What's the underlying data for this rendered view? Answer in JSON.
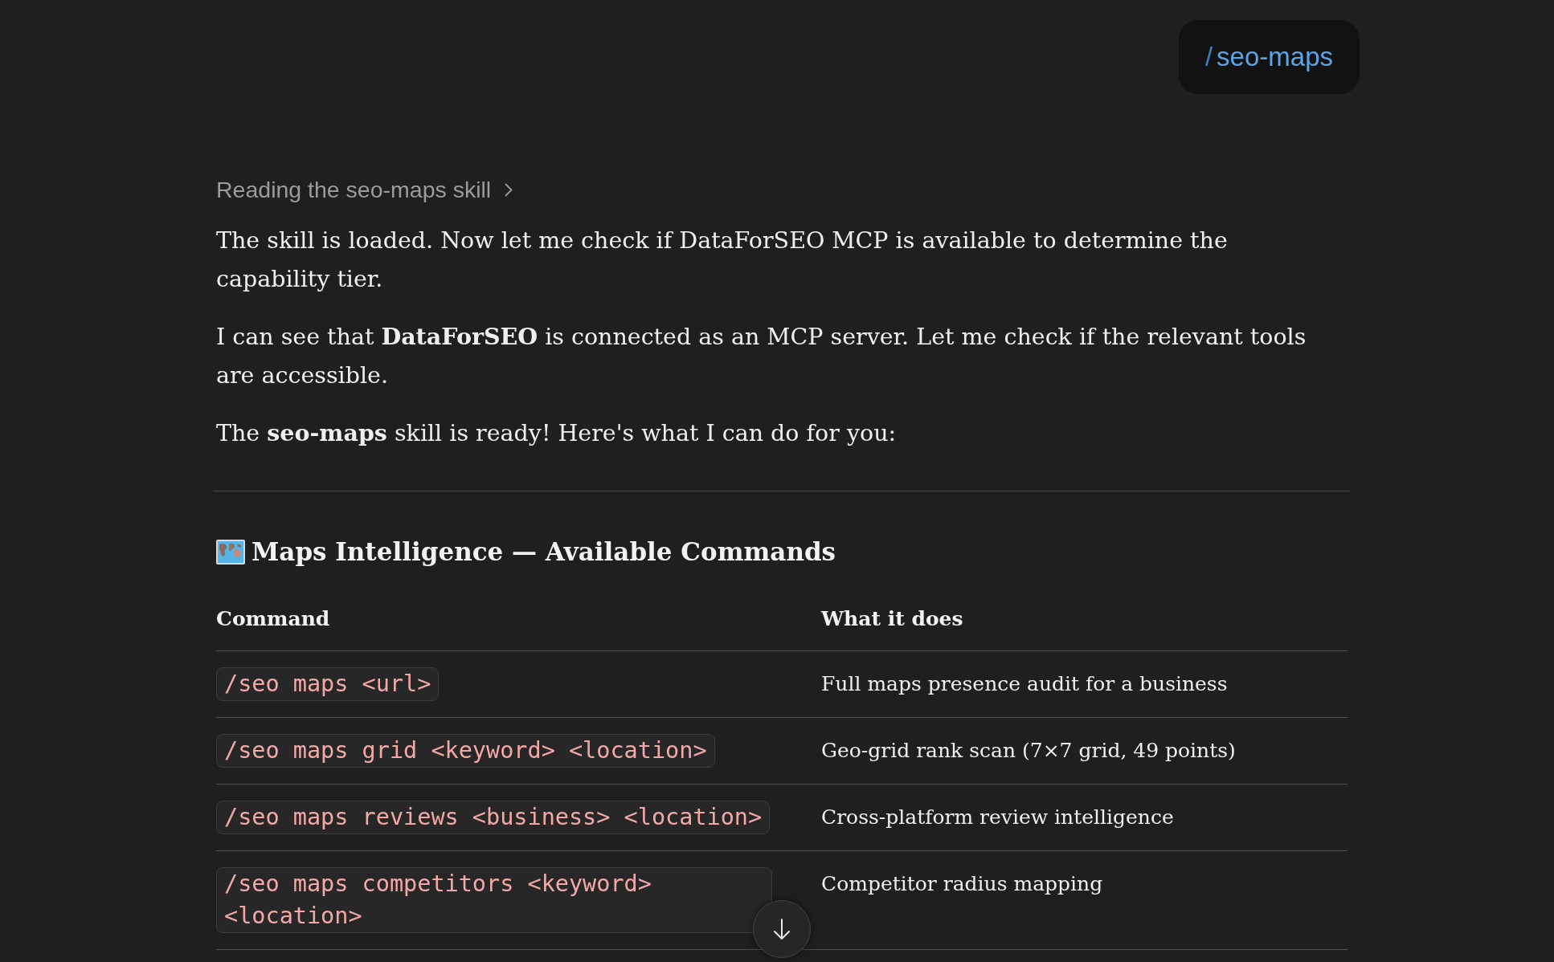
{
  "user_message": {
    "prefix": "/",
    "command": "seo-maps"
  },
  "skill_toggle": {
    "label": "Reading the seo-maps skill",
    "expanded": false
  },
  "paragraphs": [
    "The skill is loaded. Now let me check if DataForSEO MCP is available to determine the capability tier.",
    "I can see that **DataForSEO** is connected as an MCP server. Let me check if the relevant tools are accessible.",
    "The **seo-maps** skill is ready! Here's what I can do for you:"
  ],
  "heading": "Maps Intelligence — Available Commands",
  "table": {
    "columns": [
      "Command",
      "What it does"
    ],
    "rows": [
      {
        "command": "/seo maps <url>",
        "description": "Full maps presence audit for a business"
      },
      {
        "command": "/seo maps grid <keyword> <location>",
        "description": "Geo-grid rank scan (7×7 grid, 49 points)"
      },
      {
        "command": "/seo maps reviews <business> <location>",
        "description": "Cross-platform review intelligence"
      },
      {
        "command": "/seo maps competitors <keyword> <location>",
        "description": "Competitor radius mapping"
      }
    ]
  }
}
